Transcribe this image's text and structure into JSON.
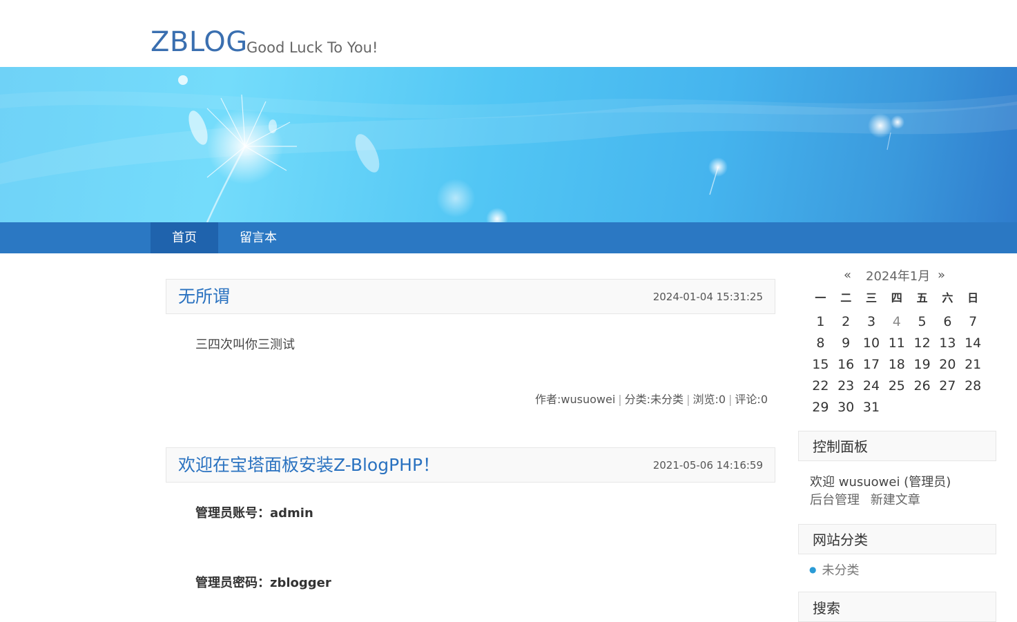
{
  "header": {
    "logo": "ZBLOG",
    "slogan": "Good Luck To You!"
  },
  "nav": {
    "items": [
      "首页",
      "留言本"
    ]
  },
  "posts": [
    {
      "title": "无所谓",
      "date": "2024-01-04 15:31:25",
      "body": "三四次叫你三测试",
      "meta": {
        "author": "作者:wusuowei",
        "category": "分类:未分类",
        "views": "浏览:0",
        "comments": "评论:0"
      }
    },
    {
      "title": "欢迎在宝塔面板安装Z-BlogPHP！",
      "date": "2021-05-06 14:16:59",
      "lines": [
        "管理员账号：admin",
        "管理员密码：zblogger"
      ]
    }
  ],
  "calendar": {
    "prev": "«",
    "title": "2024年1月",
    "next": "»",
    "weekdays": [
      "一",
      "二",
      "三",
      "四",
      "五",
      "六",
      "日"
    ],
    "days": [
      "1",
      "2",
      "3",
      "4",
      "5",
      "6",
      "7",
      "8",
      "9",
      "10",
      "11",
      "12",
      "13",
      "14",
      "15",
      "16",
      "17",
      "18",
      "19",
      "20",
      "21",
      "22",
      "23",
      "24",
      "25",
      "26",
      "27",
      "28",
      "29",
      "30",
      "31"
    ],
    "highlight_day": "4"
  },
  "control_panel": {
    "title": "控制面板",
    "welcome": "欢迎 wusuowei (管理员)",
    "links": [
      "后台管理",
      "新建文章"
    ]
  },
  "categories": {
    "title": "网站分类",
    "items": [
      "未分类"
    ]
  },
  "search": {
    "title": "搜索"
  },
  "colors": {
    "accent": "#2a72c0",
    "nav_bg": "#2b78c3",
    "nav_active": "#1f63ad"
  }
}
